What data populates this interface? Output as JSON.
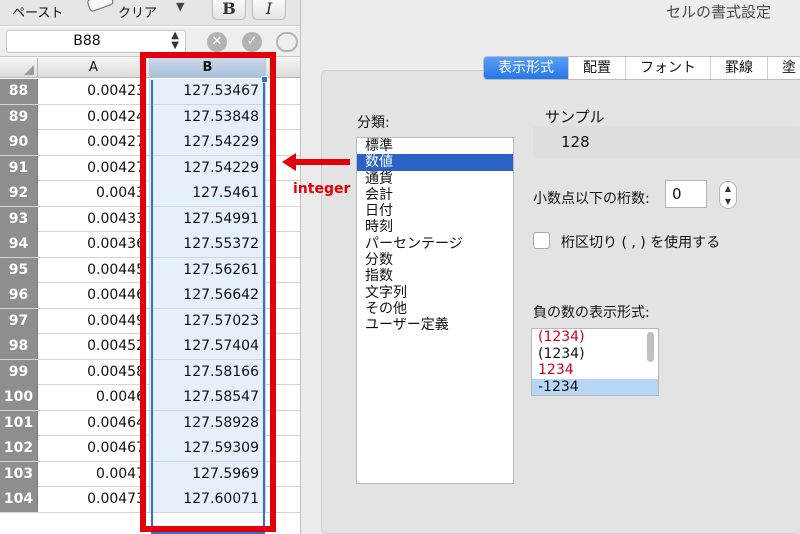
{
  "toolbar": {
    "paste_label": "ペースト",
    "clear_label": "クリア",
    "bold_label": "B",
    "italic_label": "I"
  },
  "namebox": {
    "value": "B88"
  },
  "columns": {
    "a": "A",
    "b": "B"
  },
  "rows": [
    {
      "num": "88",
      "a": "0.00423",
      "b": "127.53467"
    },
    {
      "num": "89",
      "a": "0.00424",
      "b": "127.53848"
    },
    {
      "num": "90",
      "a": "0.00427",
      "b": "127.54229"
    },
    {
      "num": "91",
      "a": "0.00427",
      "b": "127.54229"
    },
    {
      "num": "92",
      "a": "0.0043",
      "b": "127.5461"
    },
    {
      "num": "93",
      "a": "0.00433",
      "b": "127.54991"
    },
    {
      "num": "94",
      "a": "0.00436",
      "b": "127.55372"
    },
    {
      "num": "95",
      "a": "0.00445",
      "b": "127.56261"
    },
    {
      "num": "96",
      "a": "0.00446",
      "b": "127.56642"
    },
    {
      "num": "97",
      "a": "0.00449",
      "b": "127.57023"
    },
    {
      "num": "98",
      "a": "0.00452",
      "b": "127.57404"
    },
    {
      "num": "99",
      "a": "0.00458",
      "b": "127.58166"
    },
    {
      "num": "100",
      "a": "0.0046",
      "b": "127.58547"
    },
    {
      "num": "101",
      "a": "0.00464",
      "b": "127.58928"
    },
    {
      "num": "102",
      "a": "0.00467",
      "b": "127.59309"
    },
    {
      "num": "103",
      "a": "0.0047",
      "b": "127.5969"
    },
    {
      "num": "104",
      "a": "0.00473",
      "b": "127.60071"
    }
  ],
  "dialog": {
    "title": "セルの書式設定",
    "tabs": [
      "表示形式",
      "配置",
      "フォント",
      "罫線",
      "塗"
    ],
    "category_label": "分類:",
    "categories": [
      "標準",
      "数値",
      "通貨",
      "会計",
      "日付",
      "時刻",
      "パーセンテージ",
      "分数",
      "指数",
      "文字列",
      "その他",
      "ユーザー定義"
    ],
    "sample_label": "サンプル",
    "sample_value": "128",
    "decimal_label": "小数点以下の桁数:",
    "decimal_value": "0",
    "thousands_label": "桁区切り ( , ) を使用する",
    "negative_label": "負の数の表示形式:",
    "negative_formats": [
      {
        "text": "(1234)",
        "color": "#d0021b"
      },
      {
        "text": "(1234)",
        "color": "#111111"
      },
      {
        "text": "1234",
        "color": "#d0021b"
      },
      {
        "text": "-1234",
        "color": "#111111"
      }
    ]
  },
  "annotation": {
    "label": "integer",
    "color": "#e3000b"
  }
}
